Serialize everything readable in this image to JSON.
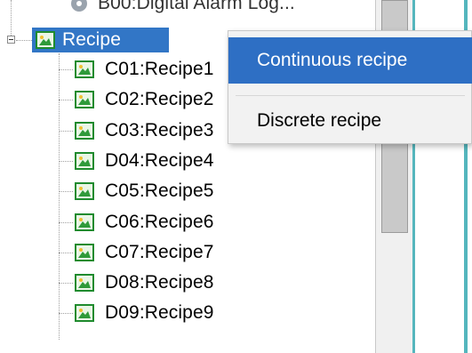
{
  "tree": {
    "top_item": {
      "label": "B00:Digital Alarm Log...",
      "icon": "gear-icon"
    },
    "folder": {
      "label": "Recipe",
      "icon": "recipe-folder-icon",
      "expander": "minus"
    },
    "children": [
      {
        "label": "C01:Recipe1",
        "icon": "recipe-item-icon"
      },
      {
        "label": "C02:Recipe2",
        "icon": "recipe-item-icon"
      },
      {
        "label": "C03:Recipe3",
        "icon": "recipe-item-icon"
      },
      {
        "label": "D04:Recipe4",
        "icon": "recipe-item-icon"
      },
      {
        "label": "C05:Recipe5",
        "icon": "recipe-item-icon"
      },
      {
        "label": "C06:Recipe6",
        "icon": "recipe-item-icon"
      },
      {
        "label": "C07:Recipe7",
        "icon": "recipe-item-icon"
      },
      {
        "label": "D08:Recipe8",
        "icon": "recipe-item-icon"
      },
      {
        "label": "D09:Recipe9",
        "icon": "recipe-item-icon"
      }
    ]
  },
  "context_menu": {
    "items": [
      {
        "label": "Continuous recipe",
        "highlighted": true
      },
      {
        "label": "Discrete recipe",
        "highlighted": false
      }
    ]
  },
  "colors": {
    "selection": "#3276c6",
    "menu_highlight": "#2e6fc4",
    "icon_green": "#1f8b2e",
    "accent_teal": "#55b6bd"
  }
}
